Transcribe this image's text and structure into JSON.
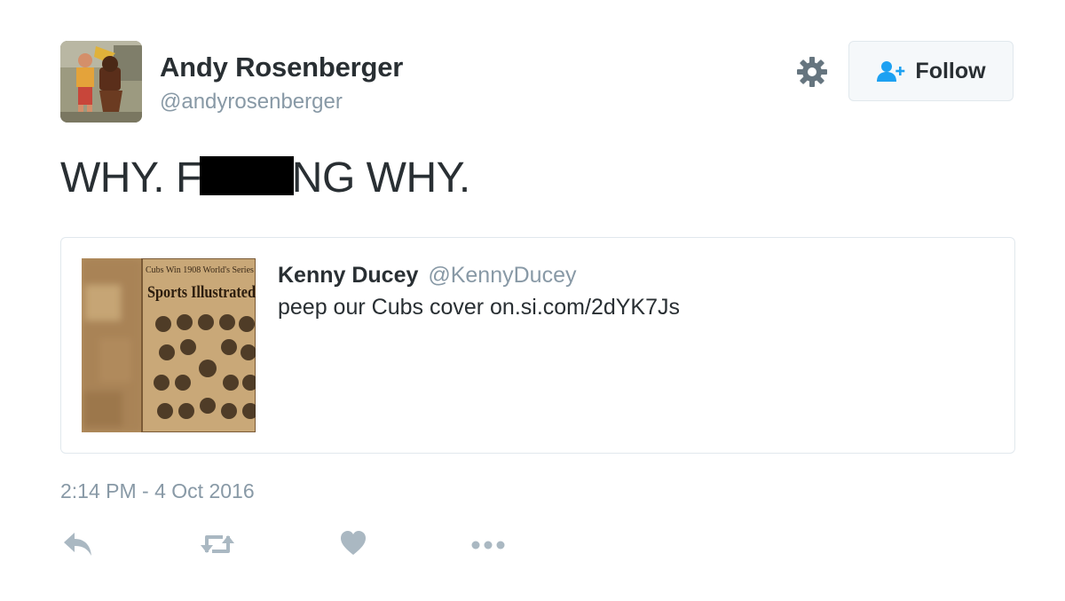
{
  "author": {
    "name": "Andy Rosenberger",
    "handle": "@andyrosenberger"
  },
  "header": {
    "follow_label": "Follow"
  },
  "tweet": {
    "text_before_redaction": "WHY. F",
    "text_after_redaction": "NG WHY.",
    "timestamp": "2:14 PM - 4 Oct 2016"
  },
  "quoted_tweet": {
    "name": "Kenny Ducey",
    "handle": "@KennyDucey",
    "text": "peep our Cubs cover on.si.com/2dYK7Js",
    "thumbnail": {
      "headline": "Cubs Win 1908 World's Series",
      "masthead": "Sports Illustrated"
    }
  },
  "actions": {
    "icons": [
      "reply-icon",
      "retweet-icon",
      "like-icon",
      "more-icon"
    ]
  },
  "colors": {
    "text": "#292f33",
    "muted": "#8899a6",
    "follow_icon": "#1da1f2",
    "border": "#e1e8ed"
  }
}
